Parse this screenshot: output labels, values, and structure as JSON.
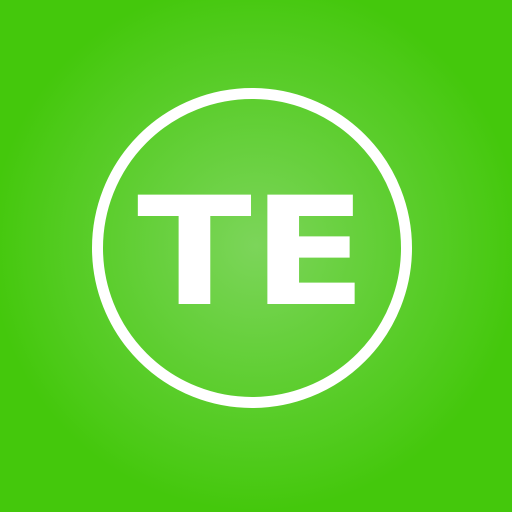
{
  "app_icon": {
    "monogram": "TE",
    "colors": {
      "background_center": "#7cd55a",
      "background_edge": "#44c80c",
      "foreground": "#ffffff"
    }
  }
}
